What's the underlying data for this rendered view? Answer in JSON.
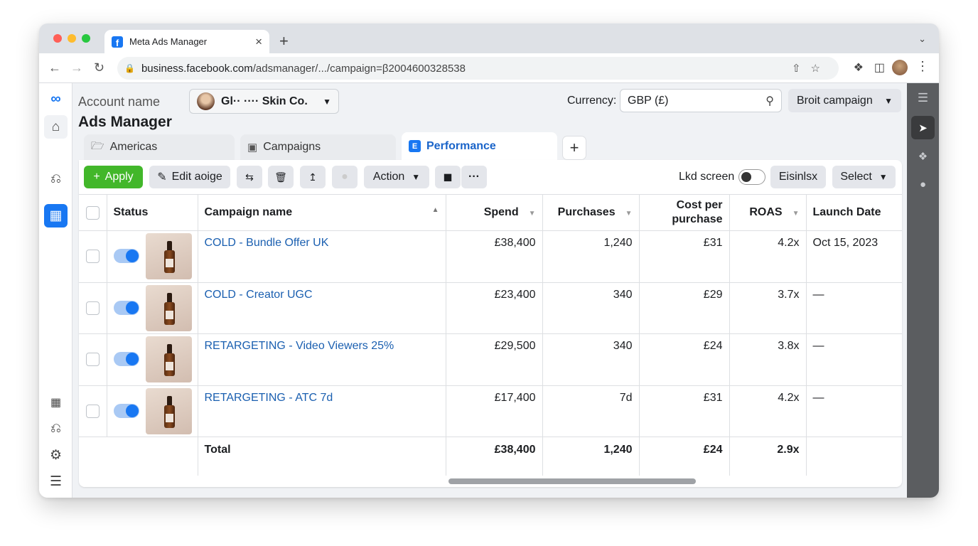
{
  "browser": {
    "tab_title": "Meta Ads Manager",
    "url_domain": "business.facebook.com",
    "url_path": "/adsmanager/.../campaign=β2004600328538"
  },
  "header": {
    "account_label": "Account name",
    "title": "Ads Manager",
    "account_name": "Gl·· ···· Skin Co.",
    "currency_label": "Currency:",
    "currency_value": "GBP (£)",
    "campaign_button": "Broit campaign"
  },
  "view_tabs": [
    {
      "label": "Americas",
      "icon": "folder-icon"
    },
    {
      "label": "Campaigns",
      "icon": "camera-folder-icon"
    },
    {
      "label": "Performance",
      "icon": "report-icon"
    }
  ],
  "toolbar": {
    "apply": "Apply",
    "edit": "Edit aoige",
    "action": "Action",
    "lkd_screen": "Lkd screen",
    "export": "Eisinlsx",
    "select": "Select"
  },
  "table": {
    "columns": [
      "Status",
      "Campaign name",
      "Spend",
      "Purchases",
      "Cost per purchase",
      "ROAS",
      "Launch Date"
    ],
    "rows": [
      {
        "name": "COLD - Bundle Offer UK",
        "spend": "£38,400",
        "purchases": "1,240",
        "cpp": "£31",
        "roas": "4.2x",
        "launch": "Oct 15, 2023",
        "active": true
      },
      {
        "name": "COLD - Creator UGC",
        "spend": "£23,400",
        "purchases": "340",
        "cpp": "£29",
        "roas": "3.7x",
        "launch": "—",
        "active": true
      },
      {
        "name": "RETARGETING - Video Viewers 25%",
        "spend": "£29,500",
        "purchases": "340",
        "cpp": "£24",
        "roas": "3.8x",
        "launch": "—",
        "active": true
      },
      {
        "name": "RETARGETING - ATC 7d",
        "spend": "£17,400",
        "purchases": "7d",
        "cpp": "£31",
        "roas": "4.2x",
        "launch": "—",
        "active": true
      }
    ],
    "total": {
      "label": "Total",
      "spend": "£38,400",
      "purchases": "1,240",
      "cpp": "£24",
      "roas": "2.9x"
    }
  },
  "colors": {
    "brand": "#1877f2",
    "apply_green": "#42b72a",
    "link": "#1a5fb0"
  }
}
